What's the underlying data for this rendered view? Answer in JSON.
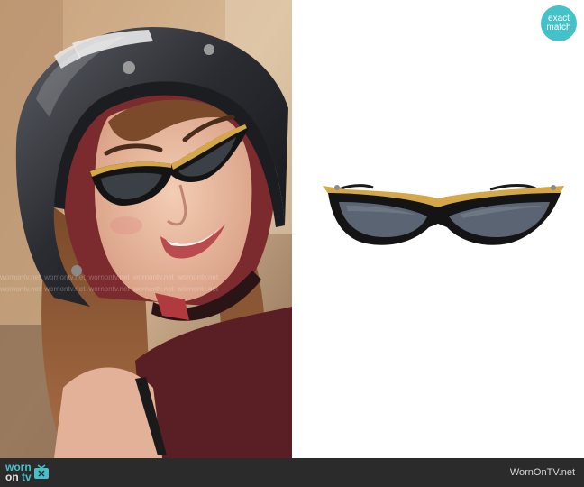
{
  "badge": {
    "line1": "exact",
    "line2": "match"
  },
  "footer": {
    "logo_worn": "worn",
    "logo_on": "on",
    "logo_tv": "tv",
    "site_name": "WornOnTV.net"
  },
  "watermark": {
    "text": "wornontv.net"
  },
  "colors": {
    "accent": "#45c2c9",
    "footer_bg": "#2b2b2b",
    "frame_gold": "#d4a84a",
    "frame_black": "#141414",
    "lens": "#5a6472"
  },
  "icons": {
    "tv_logo": "tv-icon"
  }
}
